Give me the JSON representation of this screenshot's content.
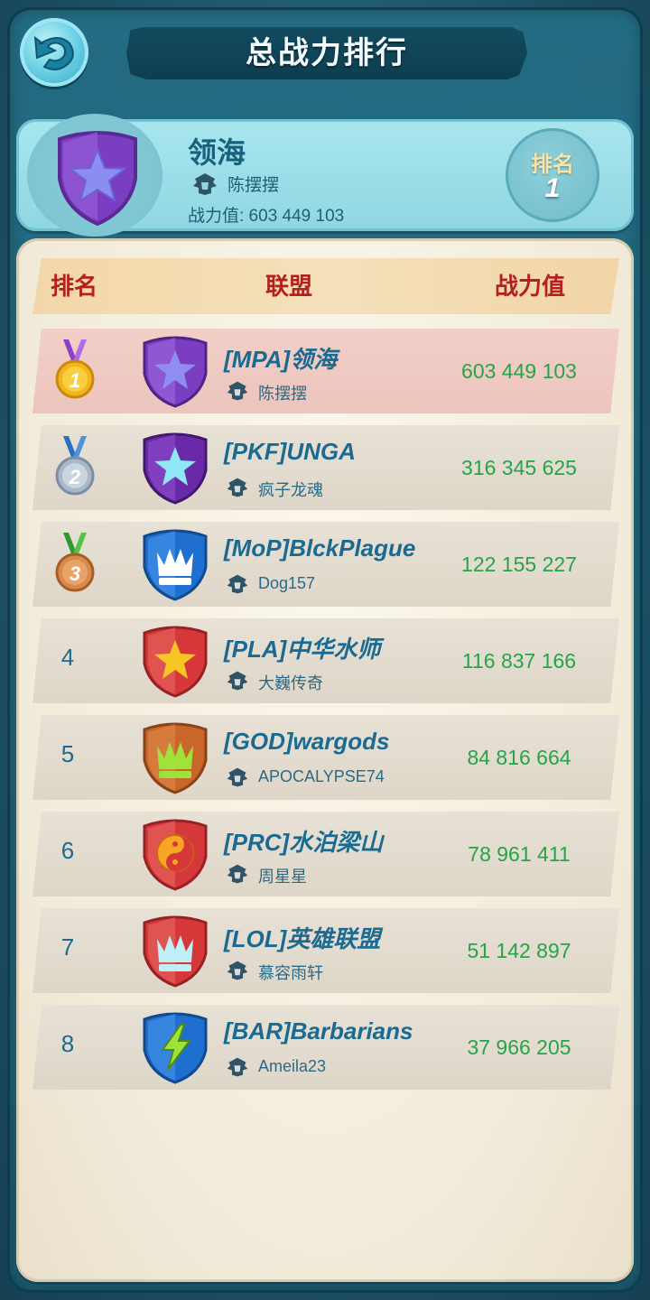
{
  "header": {
    "title": "总战力排行"
  },
  "my_alliance": {
    "name": "领海",
    "leader": "陈摆摆",
    "power_text": "战力值: 603 449 103",
    "rank_label": "排名",
    "rank_value": "1",
    "emblem": "purple-star-shield-icon"
  },
  "table": {
    "columns": [
      "排名",
      "联盟",
      "战力值"
    ],
    "rows": [
      {
        "rank": "1",
        "medal": "gold-medal-icon",
        "alliance": "[MPA]领海",
        "leader": "陈摆摆",
        "power": "603 449 103",
        "emblem": "purple-star-shield-icon"
      },
      {
        "rank": "2",
        "medal": "silver-medal-icon",
        "alliance": "[PKF]UNGA",
        "leader": "疯子龙魂",
        "power": "316 345 625",
        "emblem": "violet-star-shield-icon"
      },
      {
        "rank": "3",
        "medal": "bronze-medal-icon",
        "alliance": "[MoP]BlckPlague",
        "leader": "Dog157",
        "power": "122 155 227",
        "emblem": "blue-crown-shield-icon"
      },
      {
        "rank": "4",
        "alliance": "[PLA]中华水师",
        "leader": "大巍传奇",
        "power": "116 837 166",
        "emblem": "red-star-shield-icon"
      },
      {
        "rank": "5",
        "alliance": "[GOD]wargods",
        "leader": "APOCALYPSE74",
        "power": "84 816 664",
        "emblem": "orange-crown-shield-icon"
      },
      {
        "rank": "6",
        "alliance": "[PRC]水泊梁山",
        "leader": "周星星",
        "power": "78 961 411",
        "emblem": "red-yin-yang-shield-icon"
      },
      {
        "rank": "7",
        "alliance": "[LOL]英雄联盟",
        "leader": "慕容雨轩",
        "power": "51 142 897",
        "emblem": "red-crown-shield-icon"
      },
      {
        "rank": "8",
        "alliance": "[BAR]Barbarians",
        "leader": "Ameila23",
        "power": "37 966 205",
        "emblem": "blue-lightning-shield-icon"
      }
    ]
  },
  "colors": {
    "rank_text": "#1e6a8f",
    "power_text": "#27a348",
    "header_text": "#b3201f",
    "top_row_bg": "#f2cfc7"
  }
}
